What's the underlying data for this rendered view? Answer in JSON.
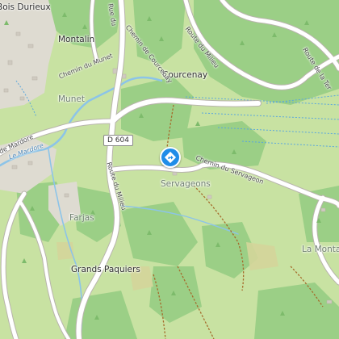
{
  "map": {
    "places": {
      "bois_durieux": "Bois Durieux",
      "montalin": "Montalin",
      "munet": "Munet",
      "courcenay": "Courcenay",
      "servageons": "Servageons",
      "farjas": "Farjas",
      "grands_paquiers": "Grands Paquiers",
      "la_monta": "La Monta"
    },
    "streets": {
      "rue_du": "Rue du",
      "chemin_de_courcenay": "Chemin de Courcenay",
      "route_du_milieu_top": "Route du Milieu",
      "route_de_la_ter": "Route de la Ter",
      "chemin_du_munet": "Chemin du Munet",
      "de_mardore": "de Mardore",
      "route_du_milieu": "Route du Milieu",
      "chemin_du_servageon": "Chemin du Servageon"
    },
    "water": {
      "le_mardore": "Le Mardore"
    },
    "road_shield": "D 604",
    "marker_icon": "directions-diamond-icon",
    "colors": {
      "meadow": "#c8e2a2",
      "forest": "#9cd087",
      "urban": "#dedbd1",
      "road": "#ffffff",
      "river": "#8cc4e8",
      "marker": "#1f8de8",
      "trail": "#a56b2b"
    }
  }
}
